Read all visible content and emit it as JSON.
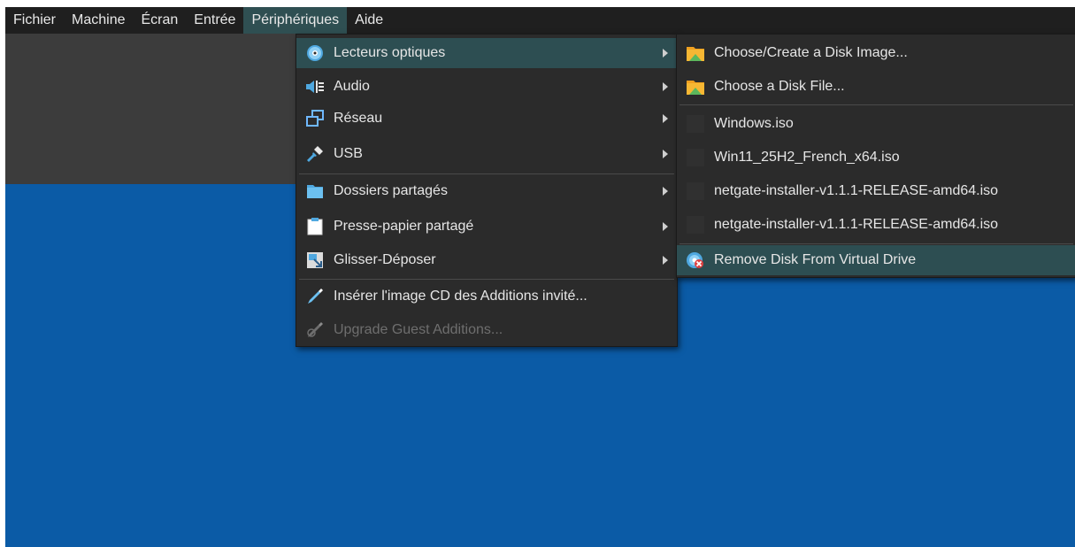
{
  "menubar": {
    "items": [
      "Fichier",
      "Machine",
      "Écran",
      "Entrée",
      "Périphériques",
      "Aide"
    ],
    "active_index": 4
  },
  "peripheriques_menu": {
    "items": [
      {
        "label": "Lecteurs optiques",
        "icon": "optical-disc-icon",
        "submenu": true,
        "highlighted": true
      },
      {
        "label": "Audio",
        "icon": "audio-icon",
        "submenu": true
      },
      {
        "label": "Réseau",
        "icon": "network-icon",
        "submenu": true
      },
      {
        "label": "USB",
        "icon": "usb-icon",
        "submenu": true
      },
      {
        "label": "Dossiers partagés",
        "icon": "shared-folder-icon",
        "submenu": true
      },
      {
        "label": "Presse-papier partagé",
        "icon": "clipboard-icon",
        "submenu": true
      },
      {
        "label": "Glisser-Déposer",
        "icon": "drag-drop-icon",
        "submenu": true
      },
      {
        "label": "Insérer l'image CD des Additions invité...",
        "icon": "guest-additions-icon",
        "submenu": false
      },
      {
        "label": "Upgrade Guest Additions...",
        "icon": "upgrade-additions-icon",
        "submenu": false,
        "disabled": true
      }
    ]
  },
  "optical_menu": {
    "items": [
      {
        "label": "Choose/Create a Disk Image...",
        "icon": "disk-image-icon"
      },
      {
        "label": "Choose a Disk File...",
        "icon": "disk-file-icon"
      },
      {
        "label": "Windows.iso",
        "icon": "iso-checkbox-icon"
      },
      {
        "label": "Win11_25H2_French_x64.iso",
        "icon": "iso-checkbox-icon"
      },
      {
        "label": "netgate-installer-v1.1.1-RELEASE-amd64.iso",
        "icon": "iso-checkbox-icon"
      },
      {
        "label": "netgate-installer-v1.1.1-RELEASE-amd64.iso",
        "icon": "iso-checkbox-icon"
      },
      {
        "label": "Remove Disk From Virtual Drive",
        "icon": "remove-disk-icon",
        "highlighted": true
      }
    ]
  },
  "colors": {
    "menubar_bg": "#1f1f1f",
    "menu_bg": "#2b2b2b",
    "highlight": "#2d4e52",
    "guest_screen": "#0b5ba6"
  }
}
